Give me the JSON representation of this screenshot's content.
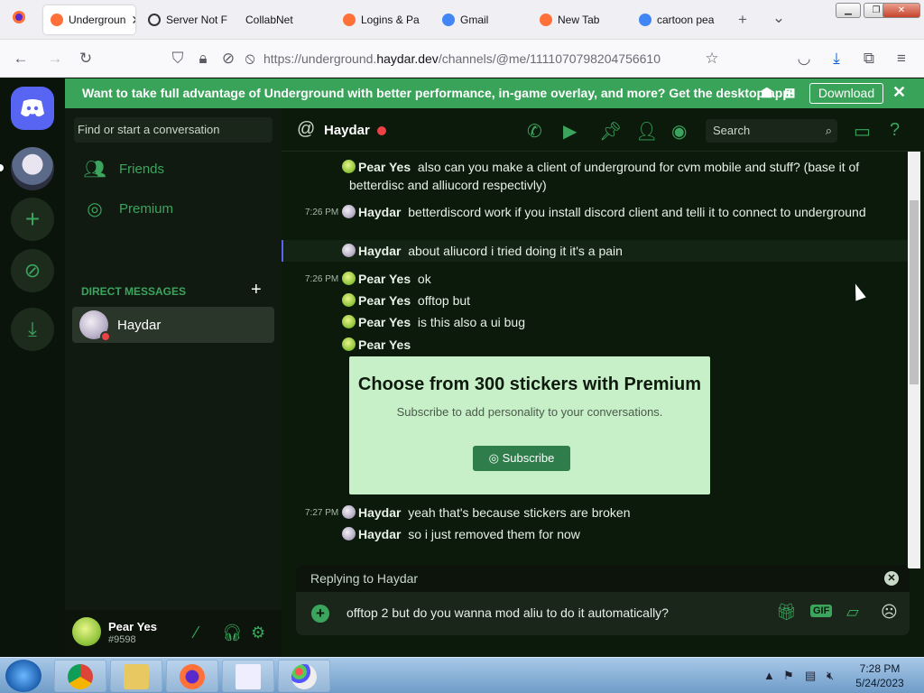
{
  "browser": {
    "tabs": [
      {
        "label": "Undergroun",
        "active": true,
        "favicon_color": "#ff7139"
      },
      {
        "label": "Server Not F",
        "active": false,
        "favicon_color": "#333333"
      },
      {
        "label": "CollabNet",
        "active": false,
        "favicon_color": "#cccccc"
      },
      {
        "label": "Logins & Pa",
        "active": false,
        "favicon_color": "#ff7139"
      },
      {
        "label": "Gmail",
        "active": false,
        "favicon_color": "#4285f4"
      },
      {
        "label": "New Tab",
        "active": false,
        "favicon_color": "#ff7139"
      },
      {
        "label": "cartoon pea",
        "active": false,
        "favicon_color": "#4285f4"
      }
    ],
    "new_tab_icon": "+",
    "list_tabs_icon": "⌄",
    "url_prefix": "https://underground.",
    "url_domain": "haydar.dev",
    "url_path": "/channels/@me/1111070798204756610"
  },
  "banner": {
    "text": "Want to take full advantage of Underground with better performance, in-game overlay, and more? Get the desktop app!",
    "download_label": "Download",
    "close_icon": "✕"
  },
  "sidebar": {
    "search_placeholder": "Find or start a conversation",
    "friends_label": "Friends",
    "premium_label": "Premium",
    "dm_header": "DIRECT MESSAGES",
    "dm_add": "+",
    "dm_user": "Haydar"
  },
  "user_panel": {
    "name": "Pear Yes",
    "tag": "#9598"
  },
  "chat_header": {
    "at": "@",
    "name": "Haydar",
    "search_placeholder": "Search"
  },
  "messages": [
    {
      "time": "",
      "author": "Pear Yes",
      "avatar": "pear",
      "text": "also can you make a client of underground for cvm mobile and stuff? (base it of betterdisc and alliucord respectivly)",
      "highlight": false
    },
    {
      "time": "7:26 PM",
      "author": "Haydar",
      "avatar": "hay",
      "text": "betterdiscord work if you install discord client and telli it to connect to underground",
      "highlight": false
    },
    {
      "time": "",
      "author": "Haydar",
      "avatar": "hay",
      "text": "about aliucord i tried doing it it's a pain",
      "highlight": true
    },
    {
      "time": "7:26 PM",
      "author": "Pear Yes",
      "avatar": "pear",
      "text": "ok",
      "highlight": false
    },
    {
      "time": "",
      "author": "Pear Yes",
      "avatar": "pear",
      "text": "offtop but",
      "highlight": false
    },
    {
      "time": "",
      "author": "Pear Yes",
      "avatar": "pear",
      "text": "is this also a ui bug",
      "highlight": false
    },
    {
      "time": "",
      "author": "Pear Yes",
      "avatar": "pear",
      "text": "",
      "highlight": false
    },
    {
      "time": "7:27 PM",
      "author": "Haydar",
      "avatar": "hay",
      "text": "yeah that's because stickers are broken",
      "highlight": false
    },
    {
      "time": "",
      "author": "Haydar",
      "avatar": "hay",
      "text": "so i just removed them for now",
      "highlight": false
    }
  ],
  "sticker_promo": {
    "title": "Choose from 300 stickers with Premium",
    "subtitle": "Subscribe to add personality to your conversations.",
    "button": "Subscribe"
  },
  "composer": {
    "replying_label": "Replying to Haydar",
    "value": "offtop 2 but do you wanna mod aliu to do it automatically?",
    "gif_label": "GIF"
  },
  "taskbar": {
    "time": "7:28 PM",
    "date": "5/24/2023"
  }
}
